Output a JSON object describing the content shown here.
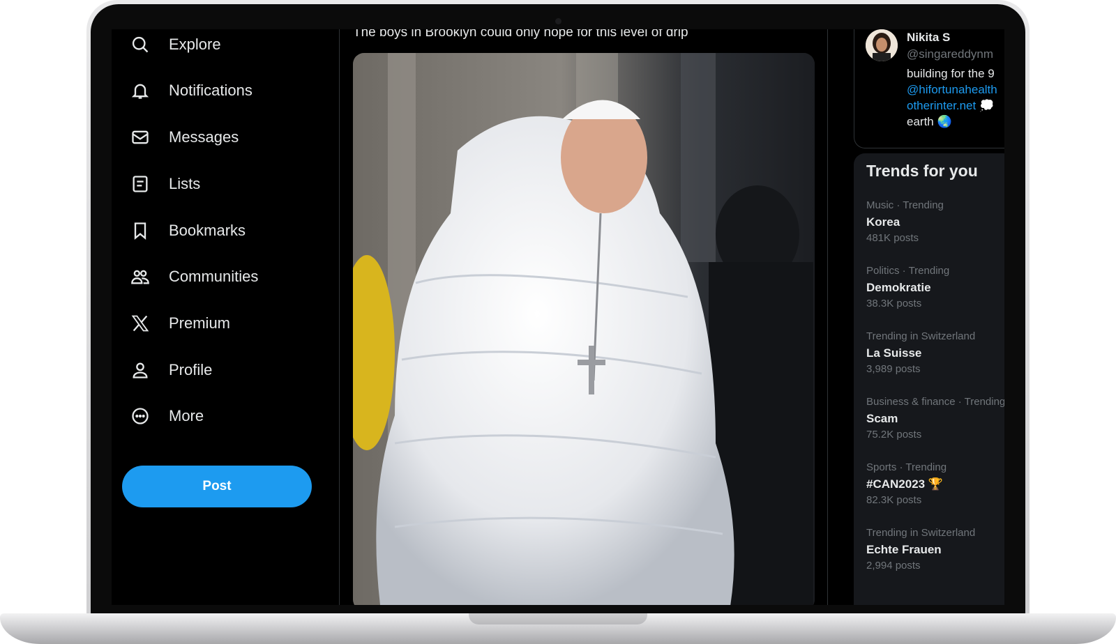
{
  "nav": {
    "items": [
      {
        "label": "Explore",
        "icon": "search-icon"
      },
      {
        "label": "Notifications",
        "icon": "bell-icon"
      },
      {
        "label": "Messages",
        "icon": "envelope-icon"
      },
      {
        "label": "Lists",
        "icon": "list-icon"
      },
      {
        "label": "Bookmarks",
        "icon": "bookmark-icon"
      },
      {
        "label": "Communities",
        "icon": "people-icon"
      },
      {
        "label": "Premium",
        "icon": "x-logo-icon"
      },
      {
        "label": "Profile",
        "icon": "person-icon"
      },
      {
        "label": "More",
        "icon": "more-circle-icon"
      }
    ],
    "post_label": "Post"
  },
  "post": {
    "text": "The boys in Brooklyn could only hope for this level of drip",
    "media_icon": "photo"
  },
  "profile_card": {
    "name": "Nikita S",
    "handle": "@singareddynm",
    "bio_line1": "building for the 9",
    "bio_link1": "@hifortunahealth",
    "bio_link2": "otherinter.net",
    "bio_emoji2": "💭",
    "bio_line4": "earth",
    "bio_emoji4": "🌏"
  },
  "trends": {
    "title": "Trends for you",
    "items": [
      {
        "meta": "Music · Trending",
        "name": "Korea",
        "count": "481K posts"
      },
      {
        "meta": "Politics · Trending",
        "name": "Demokratie",
        "count": "38.3K posts"
      },
      {
        "meta": "Trending in Switzerland",
        "name": "La Suisse",
        "count": "3,989 posts"
      },
      {
        "meta": "Business & finance · Trending",
        "name": "Scam",
        "count": "75.2K posts"
      },
      {
        "meta": "Sports · Trending",
        "name": "#CAN2023 🏆",
        "count": "82.3K posts"
      },
      {
        "meta": "Trending in Switzerland",
        "name": "Echte Frauen",
        "count": "2,994 posts"
      }
    ]
  },
  "colors": {
    "accent": "#1d9bf0",
    "background": "#000000",
    "text": "#e7e9ea",
    "muted": "#71767b"
  }
}
